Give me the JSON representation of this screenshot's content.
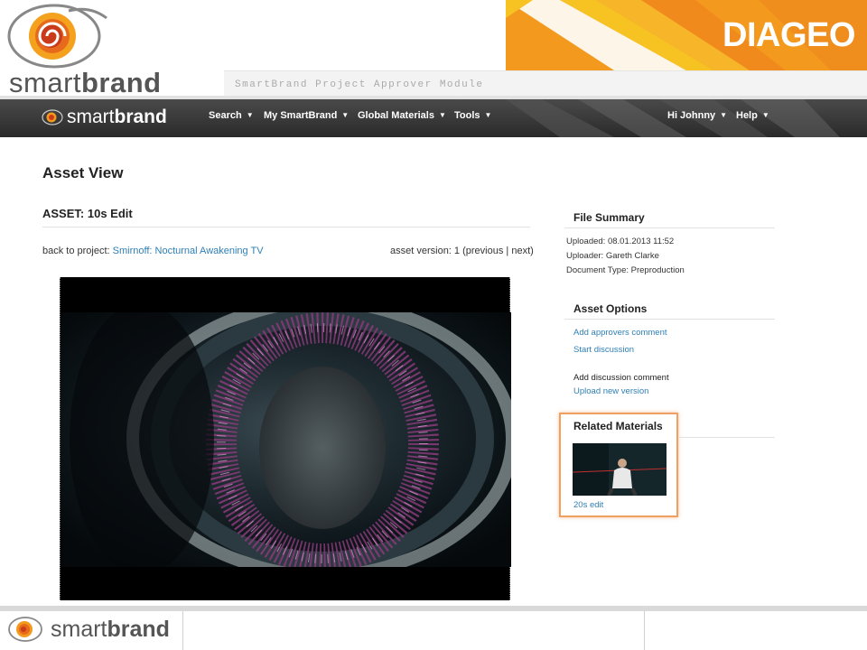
{
  "branding": {
    "smartbrand_light": "smart",
    "smartbrand_bold": "brand",
    "diageo": "DIAGEO",
    "module_title": "SmartBrand Project Approver Module",
    "accent_orange": "#f39a1e",
    "accent_yellow": "#f6c322"
  },
  "navbar": {
    "logo_light": "smart",
    "logo_bold": "brand",
    "items": [
      {
        "label": "Search"
      },
      {
        "label": "My SmartBrand"
      },
      {
        "label": "Global Materials"
      },
      {
        "label": "Tools"
      }
    ],
    "user": "Hi Johnny",
    "help": "Help"
  },
  "main": {
    "page_title": "Asset View",
    "asset_prefix": "ASSET:",
    "asset_name": "10s Edit",
    "back_prefix": "back to project:",
    "project_link": "Smirnoff: Nocturnal Awakening TV",
    "version_prefix": "asset version: 1 (",
    "version_previous": "previous",
    "version_sep": " | ",
    "version_next": "next",
    "version_suffix": ")"
  },
  "sidebar": {
    "file_summary": {
      "heading": "File Summary",
      "uploaded": "Uploaded: 08.01.2013 11:52",
      "uploader": "Uploader: Gareth Clarke",
      "doc_type": "Document Type: Preproduction"
    },
    "asset_options": {
      "heading": "Asset Options",
      "add_approvers_comment": "Add approvers comment",
      "start_discussion": "Start discussion",
      "add_discussion_comment": "Add discussion comment",
      "upload_new_version": "Upload new version"
    },
    "related": {
      "heading": "Related Materials",
      "item_label": "20s edit"
    }
  },
  "footer": {
    "wordmark_light": "smart",
    "wordmark_bold": "brand"
  }
}
